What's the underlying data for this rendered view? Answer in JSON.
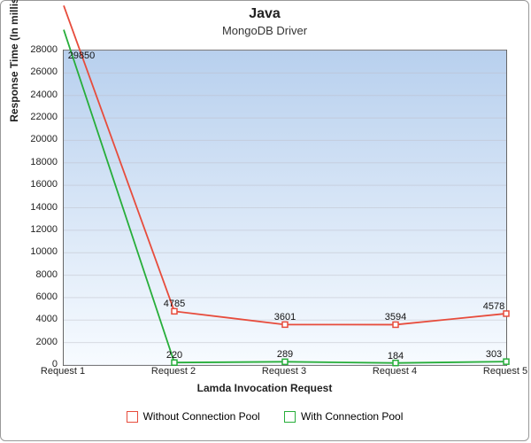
{
  "chart_data": {
    "type": "line",
    "title": "Java",
    "subtitle": "MongoDB Driver",
    "xlabel": "Lamda Invocation Request",
    "ylabel": "Response Time (In milliseconds)",
    "categories": [
      "Request 1",
      "Request 2",
      "Request 3",
      "Request 4",
      "Request 5"
    ],
    "ylim": [
      0,
      28000
    ],
    "y_ticks": [
      0,
      2000,
      4000,
      6000,
      8000,
      10000,
      12000,
      14000,
      16000,
      18000,
      20000,
      22000,
      24000,
      26000,
      28000
    ],
    "series": [
      {
        "name": "Without Connection Pool",
        "color": "#e74c3c",
        "values": [
          32000,
          4785,
          3601,
          3594,
          4578
        ],
        "labels": [
          "",
          "4785",
          "3601",
          "3594",
          "4578"
        ]
      },
      {
        "name": "With Connection Pool",
        "color": "#27ae3a",
        "values": [
          29850,
          220,
          289,
          184,
          303
        ],
        "labels": [
          "29850",
          "220",
          "289",
          "184",
          "303"
        ]
      }
    ],
    "legend_position": "bottom"
  }
}
